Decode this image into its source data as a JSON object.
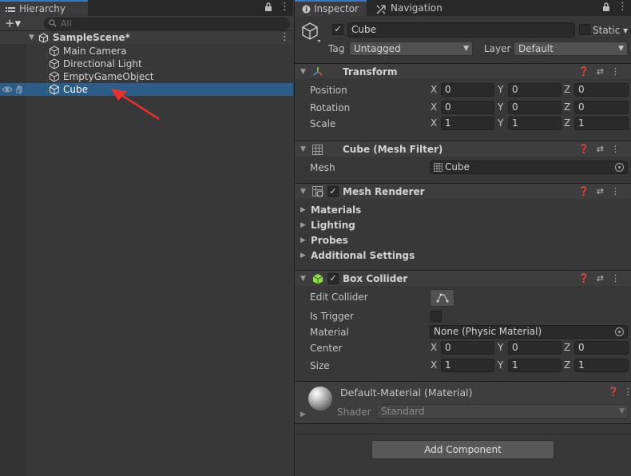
{
  "hierarchy": {
    "tab_label": "Hierarchy",
    "add_label": "+▾",
    "search_placeholder": "All",
    "scene_name": "SampleScene*",
    "items": [
      {
        "label": "Main Camera"
      },
      {
        "label": "Directional Light"
      },
      {
        "label": "EmptyGameObject"
      },
      {
        "label": "Cube",
        "selected": true
      }
    ]
  },
  "inspector": {
    "tabs": [
      {
        "label": "Inspector",
        "icon": "info-icon",
        "active": true
      },
      {
        "label": "Navigation",
        "icon": "navigation-icon",
        "active": false
      }
    ],
    "object": {
      "name": "Cube",
      "active": true,
      "static_label": "Static",
      "static": false,
      "tag_label": "Tag",
      "tag_value": "Untagged",
      "layer_label": "Layer",
      "layer_value": "Default"
    },
    "transform": {
      "title": "Transform",
      "position": {
        "label": "Position",
        "x": "0",
        "y": "0",
        "z": "0"
      },
      "rotation": {
        "label": "Rotation",
        "x": "0",
        "y": "0",
        "z": "0"
      },
      "scale": {
        "label": "Scale",
        "x": "1",
        "y": "1",
        "z": "1"
      }
    },
    "mesh_filter": {
      "title": "Cube (Mesh Filter)",
      "mesh_label": "Mesh",
      "mesh_value": "Cube"
    },
    "mesh_renderer": {
      "title": "Mesh Renderer",
      "enabled": true,
      "foldouts": [
        "Materials",
        "Lighting",
        "Probes",
        "Additional Settings"
      ]
    },
    "box_collider": {
      "title": "Box Collider",
      "enabled": true,
      "edit_collider_label": "Edit Collider",
      "is_trigger_label": "Is Trigger",
      "is_trigger": false,
      "material_label": "Material",
      "material_value": "None (Physic Material)",
      "center": {
        "label": "Center",
        "x": "0",
        "y": "0",
        "z": "0"
      },
      "size": {
        "label": "Size",
        "x": "1",
        "y": "1",
        "z": "1"
      }
    },
    "material": {
      "title": "Default-Material (Material)",
      "shader_label": "Shader",
      "shader_value": "Standard"
    },
    "add_component_label": "Add Component",
    "axis_labels": {
      "x": "X",
      "y": "Y",
      "z": "Z"
    }
  },
  "colors": {
    "selection": "#2c5d87",
    "accent_tab": "#3a79bb",
    "arrow": "#e8322e"
  }
}
